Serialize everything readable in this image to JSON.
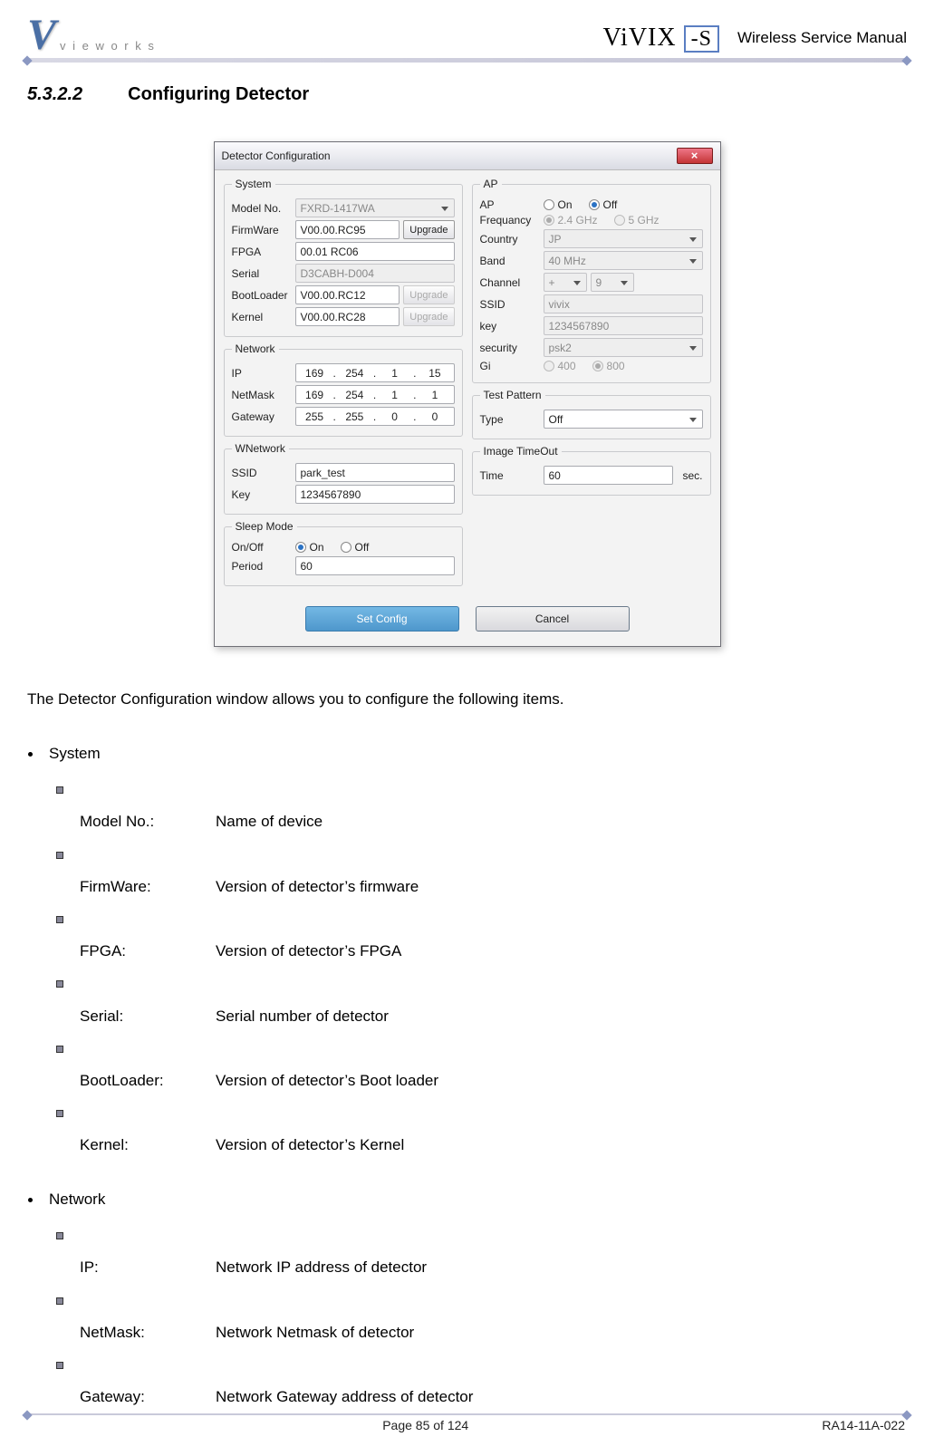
{
  "header": {
    "brand": "v i e w o r k s",
    "product": "ViVIX",
    "product_suffix": "-S",
    "manual_title": "Wireless Service Manual"
  },
  "section": {
    "number": "5.3.2.2",
    "title": "Configuring Detector"
  },
  "dialog": {
    "title": "Detector Configuration",
    "close_label": "×",
    "system": {
      "legend": "System",
      "model_no_label": "Model No.",
      "model_no": "FXRD-1417WA",
      "firmware_label": "FirmWare",
      "firmware": "V00.00.RC95",
      "upgrade_label": "Upgrade",
      "fpga_label": "FPGA",
      "fpga": "00.01 RC06",
      "serial_label": "Serial",
      "serial": "D3CABH-D004",
      "bootloader_label": "BootLoader",
      "bootloader": "V00.00.RC12",
      "kernel_label": "Kernel",
      "kernel": "V00.00.RC28"
    },
    "network": {
      "legend": "Network",
      "ip_label": "IP",
      "ip": [
        "169",
        "254",
        "1",
        "15"
      ],
      "netmask_label": "NetMask",
      "netmask": [
        "169",
        "254",
        "1",
        "1"
      ],
      "gateway_label": "Gateway",
      "gateway": [
        "255",
        "255",
        "0",
        "0"
      ]
    },
    "wnetwork": {
      "legend": "WNetwork",
      "ssid_label": "SSID",
      "ssid": "park_test",
      "key_label": "Key",
      "key": "1234567890"
    },
    "sleep": {
      "legend": "Sleep Mode",
      "onoff_label": "On/Off",
      "on_label": "On",
      "off_label": "Off",
      "period_label": "Period",
      "period": "60"
    },
    "ap": {
      "legend": "AP",
      "ap_label": "AP",
      "on_label": "On",
      "off_label": "Off",
      "freq_label": "Frequancy",
      "freq_24": "2.4 GHz",
      "freq_5": "5 GHz",
      "country_label": "Country",
      "country": "JP",
      "band_label": "Band",
      "band": "40 MHz",
      "channel_label": "Channel",
      "channel_sign": "+",
      "channel_num": "9",
      "ssid_label": "SSID",
      "ssid": "vivix",
      "key_label": "key",
      "key": "1234567890",
      "security_label": "security",
      "security": "psk2",
      "gi_label": "Gi",
      "gi_400": "400",
      "gi_800": "800"
    },
    "test": {
      "legend": "Test Pattern",
      "type_label": "Type",
      "type": "Off"
    },
    "timeout": {
      "legend": "Image TimeOut",
      "time_label": "Time",
      "time": "60",
      "unit": "sec."
    },
    "buttons": {
      "set": "Set Config",
      "cancel": "Cancel"
    }
  },
  "body": {
    "intro": "The Detector Configuration window allows you to configure the following items.",
    "groups": [
      {
        "title": "System",
        "items": [
          {
            "term": "Model No.:",
            "desc": "Name of device"
          },
          {
            "term": "FirmWare:",
            "desc": "Version of detector’s firmware"
          },
          {
            "term": "FPGA:",
            "desc": "Version of detector’s FPGA"
          },
          {
            "term": "Serial:",
            "desc": "Serial number of detector"
          },
          {
            "term": "BootLoader:",
            "desc": "Version of detector’s Boot loader"
          },
          {
            "term": "Kernel:",
            "desc": "Version of detector’s Kernel"
          }
        ]
      },
      {
        "title": "Network",
        "items": [
          {
            "term": "IP:",
            "desc": "Network IP address of detector"
          },
          {
            "term": "NetMask:",
            "desc": "Network Netmask of detector"
          },
          {
            "term": "Gateway:",
            "desc": "Network Gateway address of detector"
          }
        ]
      }
    ]
  },
  "footer": {
    "page": "Page 85 of 124",
    "doc": "RA14-11A-022"
  }
}
